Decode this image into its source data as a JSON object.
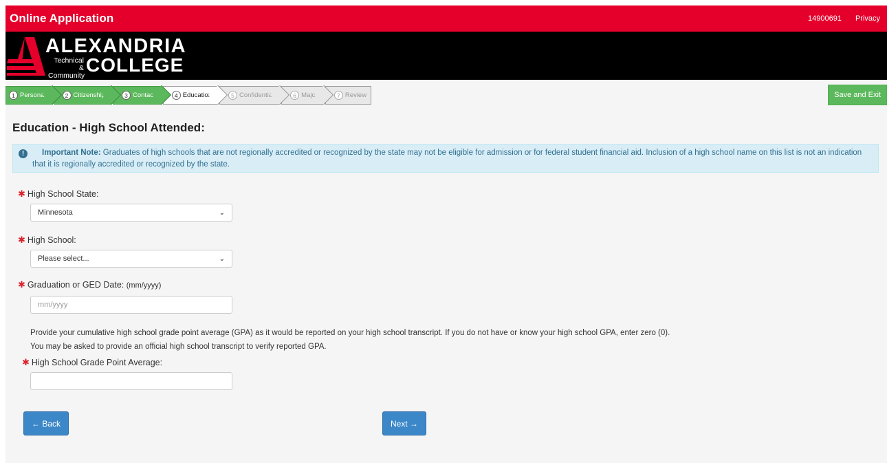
{
  "topbar": {
    "app_title": "Online Application",
    "app_id": "14900691",
    "privacy_link": "Privacy",
    "bg_color": "#e4002b"
  },
  "logo": {
    "line1": "ALEXANDRIA",
    "small_line1": "Technical &",
    "small_line2": "Community",
    "line2": "COLLEGE"
  },
  "steps": [
    {
      "num": "1",
      "label": "Personal",
      "state": "done"
    },
    {
      "num": "2",
      "label": "Citizenship",
      "state": "done"
    },
    {
      "num": "3",
      "label": "Contact",
      "state": "done"
    },
    {
      "num": "4",
      "label": "Education",
      "state": "current"
    },
    {
      "num": "5",
      "label": "Confidential",
      "state": "future"
    },
    {
      "num": "6",
      "label": "Major",
      "state": "future"
    },
    {
      "num": "7",
      "label": "Review",
      "state": "future"
    }
  ],
  "save_exit_label": "Save and Exit",
  "page_title": "Education - High School Attended:",
  "note": {
    "label": "Important Note:",
    "text": " Graduates of high schools that are not regionally accredited or recognized by the state may not be eligible for admission or for federal student financial aid. Inclusion of a high school name on this list is not an indication that it is regionally accredited or recognized by the state."
  },
  "form": {
    "state_label": "High School State:",
    "state_value": "Minnesota",
    "school_label": "High School:",
    "school_value": "Please select...",
    "grad_label": "Graduation or GED Date:",
    "grad_hint": "(mm/yyyy)",
    "grad_placeholder": "mm/yyyy",
    "gpa_paragraph": "Provide your cumulative high school grade point average (GPA) as it would be reported on your high school transcript. If you do not have or know your high school GPA, enter zero (0). You may be asked to provide an official high school transcript to verify reported GPA.",
    "gpa_label": "High School Grade Point Average:",
    "gpa_value": ""
  },
  "nav": {
    "back_label": "← Back",
    "next_label": "Next →"
  }
}
